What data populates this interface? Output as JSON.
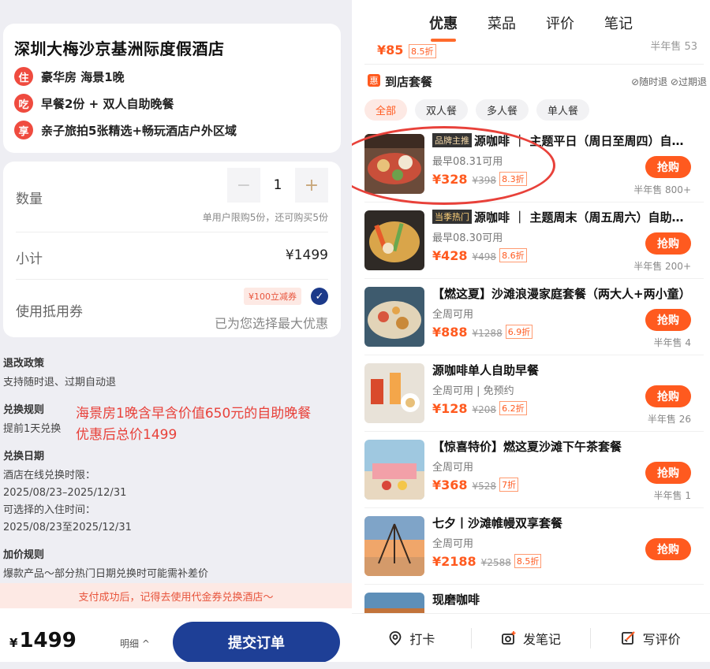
{
  "hotel": {
    "name": "深圳大梅沙京基洲际度假酒店",
    "features": [
      {
        "icon": "住",
        "text": "豪华房 海景1晚"
      },
      {
        "icon": "吃",
        "text": "早餐2份 + 双人自助晚餐"
      },
      {
        "icon": "享",
        "text": "亲子旅拍5张精选+畅玩酒店户外区域"
      }
    ]
  },
  "order": {
    "qty_label": "数量",
    "minus": "−",
    "qty_value": "1",
    "plus": "+",
    "limit_text": "单用户限购5份，还可购买5份",
    "subtotal_label": "小计",
    "subtotal_value": "¥1499",
    "coupon_label": "使用抵用券",
    "coupon_tag": "¥100立减券",
    "coupon_check": "✓",
    "coupon_best": "已为您选择最大优惠"
  },
  "rules": {
    "refund_title": "退改政策",
    "refund_text": "支持随时退、过期自动退",
    "exchange_title": "兑换规则",
    "exchange_text": "提前1天兑换",
    "date_title": "兑换日期",
    "date_line1": "酒店在线兑换时限：",
    "date_line2": "2025/08/23–2025/12/31",
    "date_line3": "可选择的入住时间：",
    "date_line4": "2025/08/23至2025/12/31",
    "addon_title": "加价规则",
    "addon_text": "爆款产品～部分热门日期兑换时可能需补差价"
  },
  "annotation": {
    "line1": "海景房1晚含早含价值650元的自助晚餐",
    "line2": "优惠后总价1499"
  },
  "pay_tip": "支付成功后，记得去使用代金券兑换酒店～",
  "bottom": {
    "currency": "¥",
    "total": "1499",
    "detail": "明细 ^",
    "submit": "提交订单"
  },
  "tabs": [
    "优惠",
    "菜品",
    "评价",
    "笔记"
  ],
  "prev_item": {
    "price": "¥85",
    "discount": "8.5折",
    "sold": "半年售 53"
  },
  "section": {
    "icon": "惠",
    "title": "到店套餐",
    "tags": "⊘随时退 ⊘过期退"
  },
  "filters": [
    "全部",
    "双人餐",
    "多人餐",
    "单人餐"
  ],
  "items": [
    {
      "badge": "品牌主推",
      "title": "源咖啡 ｜ 主题平日（周日至周四）自…",
      "sub": "最早08.31可用",
      "price": "¥328",
      "orig": "¥398",
      "disc": "8.3折",
      "buy": "抢购",
      "sold": "半年售 800+"
    },
    {
      "badge": "当季热门",
      "title": "源咖啡 ｜ 主题周末（周五周六）自助…",
      "sub": "最早08.30可用",
      "price": "¥428",
      "orig": "¥498",
      "disc": "8.6折",
      "buy": "抢购",
      "sold": "半年售 200+"
    },
    {
      "badge": "",
      "title": "【燃这夏】沙滩浪漫家庭套餐（两大人+两小童）",
      "sub": "全周可用",
      "price": "¥888",
      "orig": "¥1288",
      "disc": "6.9折",
      "buy": "抢购",
      "sold": "半年售 4"
    },
    {
      "badge": "",
      "title": "源咖啡单人自助早餐",
      "sub": "全周可用 | 免预约",
      "price": "¥128",
      "orig": "¥208",
      "disc": "6.2折",
      "buy": "抢购",
      "sold": "半年售 26"
    },
    {
      "badge": "",
      "title": "【惊喜特价】燃这夏沙滩下午茶套餐",
      "sub": "全周可用",
      "price": "¥368",
      "orig": "¥528",
      "disc": "7折",
      "buy": "抢购",
      "sold": "半年售 1"
    },
    {
      "badge": "",
      "title": "七夕丨沙滩帷幔双享套餐",
      "sub": "全周可用",
      "price": "¥2188",
      "orig": "¥2588",
      "disc": "8.5折",
      "buy": "抢购",
      "sold": ""
    },
    {
      "badge": "",
      "title": "现磨咖啡",
      "sub": "",
      "price": "",
      "orig": "",
      "disc": "",
      "buy": "",
      "sold": ""
    }
  ],
  "dock": [
    {
      "icon": "location-pin-icon",
      "label": "打卡"
    },
    {
      "icon": "camera-plus-icon",
      "label": "发笔记"
    },
    {
      "icon": "edit-review-icon",
      "label": "写评价"
    }
  ]
}
